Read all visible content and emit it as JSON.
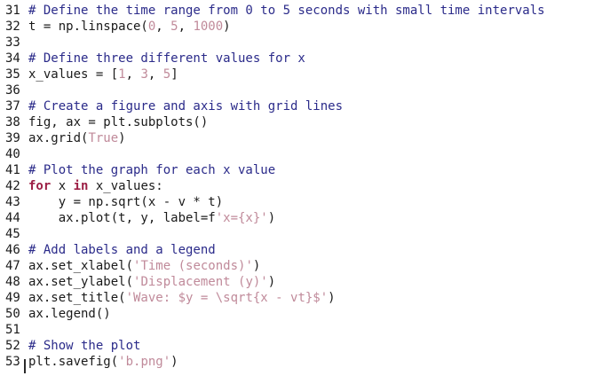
{
  "editor": {
    "lines": [
      {
        "n": "31",
        "tokens": [
          {
            "t": "comment",
            "v": "# Define the time range from 0 to 5 seconds with small time intervals"
          }
        ]
      },
      {
        "n": "32",
        "tokens": [
          {
            "t": "plain",
            "v": "t = np.linspace("
          },
          {
            "t": "num",
            "v": "0"
          },
          {
            "t": "plain",
            "v": ", "
          },
          {
            "t": "num",
            "v": "5"
          },
          {
            "t": "plain",
            "v": ", "
          },
          {
            "t": "num",
            "v": "1000"
          },
          {
            "t": "plain",
            "v": ")"
          }
        ]
      },
      {
        "n": "33",
        "tokens": []
      },
      {
        "n": "34",
        "tokens": [
          {
            "t": "comment",
            "v": "# Define three different values for x"
          }
        ]
      },
      {
        "n": "35",
        "tokens": [
          {
            "t": "plain",
            "v": "x_values = ["
          },
          {
            "t": "num",
            "v": "1"
          },
          {
            "t": "plain",
            "v": ", "
          },
          {
            "t": "num",
            "v": "3"
          },
          {
            "t": "plain",
            "v": ", "
          },
          {
            "t": "num",
            "v": "5"
          },
          {
            "t": "plain",
            "v": "]"
          }
        ]
      },
      {
        "n": "36",
        "tokens": []
      },
      {
        "n": "37",
        "tokens": [
          {
            "t": "comment",
            "v": "# Create a figure and axis with grid lines"
          }
        ]
      },
      {
        "n": "38",
        "tokens": [
          {
            "t": "plain",
            "v": "fig, ax = plt.subplots()"
          }
        ]
      },
      {
        "n": "39",
        "tokens": [
          {
            "t": "plain",
            "v": "ax.grid("
          },
          {
            "t": "bool",
            "v": "True"
          },
          {
            "t": "plain",
            "v": ")"
          }
        ]
      },
      {
        "n": "40",
        "tokens": []
      },
      {
        "n": "41",
        "tokens": [
          {
            "t": "comment",
            "v": "# Plot the graph for each x value"
          }
        ]
      },
      {
        "n": "42",
        "tokens": [
          {
            "t": "kw",
            "v": "for"
          },
          {
            "t": "plain",
            "v": " x "
          },
          {
            "t": "kw",
            "v": "in"
          },
          {
            "t": "plain",
            "v": " x_values:"
          }
        ]
      },
      {
        "n": "43",
        "tokens": [
          {
            "t": "plain",
            "v": "    y = np.sqrt(x - v * t)"
          }
        ]
      },
      {
        "n": "44",
        "tokens": [
          {
            "t": "plain",
            "v": "    ax.plot(t, y, label=f"
          },
          {
            "t": "str",
            "v": "'x={x}'"
          },
          {
            "t": "plain",
            "v": ")"
          }
        ]
      },
      {
        "n": "45",
        "tokens": []
      },
      {
        "n": "46",
        "tokens": [
          {
            "t": "comment",
            "v": "# Add labels and a legend"
          }
        ]
      },
      {
        "n": "47",
        "tokens": [
          {
            "t": "plain",
            "v": "ax.set_xlabel("
          },
          {
            "t": "str",
            "v": "'Time (seconds)'"
          },
          {
            "t": "plain",
            "v": ")"
          }
        ]
      },
      {
        "n": "48",
        "tokens": [
          {
            "t": "plain",
            "v": "ax.set_ylabel("
          },
          {
            "t": "str",
            "v": "'Displacement (y)'"
          },
          {
            "t": "plain",
            "v": ")"
          }
        ]
      },
      {
        "n": "49",
        "tokens": [
          {
            "t": "plain",
            "v": "ax.set_title("
          },
          {
            "t": "str",
            "v": "'Wave: $y = \\sqrt{x - vt}$'"
          },
          {
            "t": "plain",
            "v": ")"
          }
        ]
      },
      {
        "n": "50",
        "tokens": [
          {
            "t": "plain",
            "v": "ax.legend()"
          }
        ]
      },
      {
        "n": "51",
        "tokens": []
      },
      {
        "n": "52",
        "tokens": [
          {
            "t": "comment",
            "v": "# Show the plot"
          }
        ]
      },
      {
        "n": "53",
        "tokens": [
          {
            "t": "plain",
            "v": "plt.savefig("
          },
          {
            "t": "str",
            "v": "'b.png'"
          },
          {
            "t": "plain",
            "v": ")"
          }
        ]
      }
    ]
  },
  "colors": {
    "comment": "#2b2b8a",
    "keyword": "#9c1f45",
    "literal": "#c08a9a",
    "text": "#1a1a1a",
    "background": "#ffffff"
  }
}
